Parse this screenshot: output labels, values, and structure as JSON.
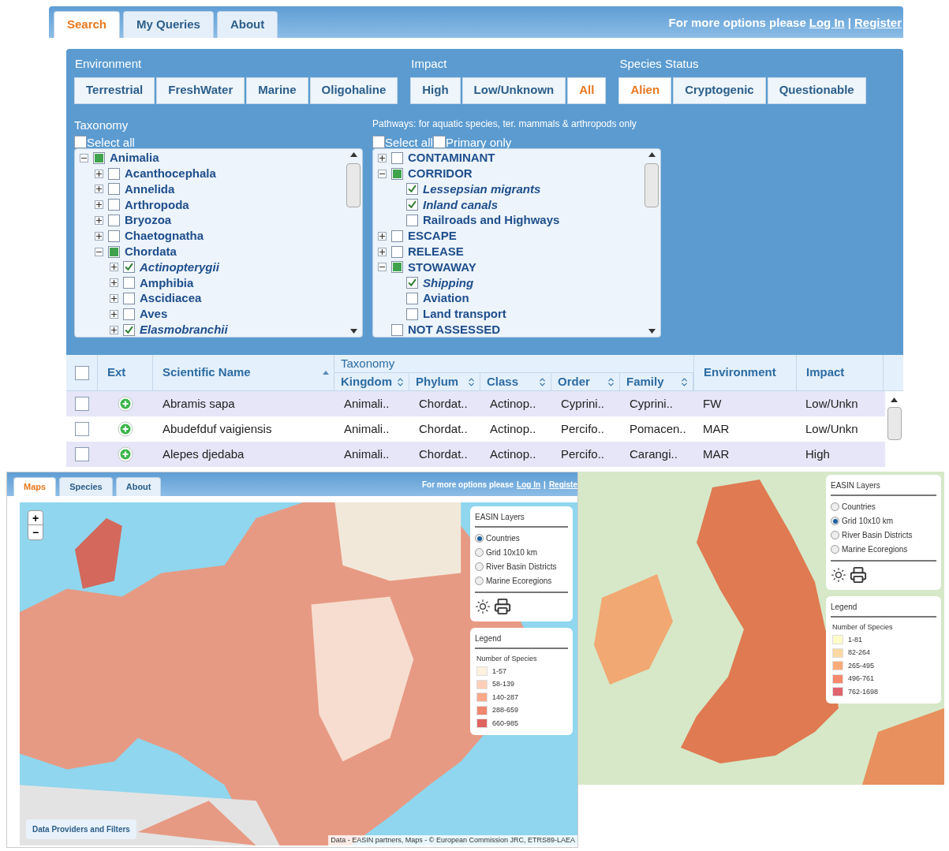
{
  "search_app": {
    "tabs": [
      {
        "label": "Search",
        "selected": true
      },
      {
        "label": "My Queries",
        "selected": false
      },
      {
        "label": "About",
        "selected": false
      }
    ],
    "login_prompt": {
      "text": "For more options please",
      "login": "Log In",
      "separator": "|",
      "register": "Register"
    },
    "filters": [
      {
        "title": "Environment",
        "options": [
          {
            "label": "Terrestrial",
            "selected": false
          },
          {
            "label": "FreshWater",
            "selected": false
          },
          {
            "label": "Marine",
            "selected": false
          },
          {
            "label": "Oligohaline",
            "selected": false
          }
        ]
      },
      {
        "title": "Impact",
        "options": [
          {
            "label": "High",
            "selected": false
          },
          {
            "label": "Low/Unknown",
            "selected": false
          },
          {
            "label": "All",
            "selected": true
          }
        ]
      },
      {
        "title": "Species Status",
        "options": [
          {
            "label": "Alien",
            "selected": true
          },
          {
            "label": "Cryptogenic",
            "selected": false
          },
          {
            "label": "Questionable",
            "selected": false
          }
        ]
      }
    ],
    "taxonomy": {
      "title": "Taxonomy",
      "select_all": {
        "label": "Select all",
        "checked": false
      },
      "tree": [
        {
          "label": "Animalia",
          "expanded": true,
          "checked": false,
          "partial": true,
          "children": [
            {
              "label": "Acanthocephala",
              "expanded": false,
              "checked": false
            },
            {
              "label": "Annelida",
              "expanded": false,
              "checked": false
            },
            {
              "label": "Arthropoda",
              "expanded": false,
              "checked": false
            },
            {
              "label": "Bryozoa",
              "expanded": false,
              "checked": false
            },
            {
              "label": "Chaetognatha",
              "expanded": false,
              "checked": false
            },
            {
              "label": "Chordata",
              "expanded": true,
              "checked": false,
              "partial": true,
              "children": [
                {
                  "label": "Actinopterygii",
                  "expanded": false,
                  "checked": true
                },
                {
                  "label": "Amphibia",
                  "expanded": false,
                  "checked": false
                },
                {
                  "label": "Ascidiacea",
                  "expanded": false,
                  "checked": false
                },
                {
                  "label": "Aves",
                  "expanded": false,
                  "checked": false
                },
                {
                  "label": "Elasmobranchii",
                  "expanded": false,
                  "checked": true
                }
              ]
            }
          ]
        }
      ]
    },
    "pathways": {
      "title": "Pathways: for aquatic species, ter. mammals & arthropods only",
      "select_all": {
        "label": "Select all",
        "checked": false
      },
      "primary_only": {
        "label": "Primary only",
        "checked": false
      },
      "tree": [
        {
          "label": "CONTAMINANT",
          "expanded": false,
          "checked": false
        },
        {
          "label": "CORRIDOR",
          "expanded": true,
          "checked": false,
          "partial": true,
          "children": [
            {
              "label": "Lessepsian migrants",
              "checked": true
            },
            {
              "label": "Inland canals",
              "checked": true
            },
            {
              "label": "Railroads and Highways",
              "checked": false
            }
          ]
        },
        {
          "label": "ESCAPE",
          "expanded": false,
          "checked": false
        },
        {
          "label": "RELEASE",
          "expanded": false,
          "checked": false
        },
        {
          "label": "STOWAWAY",
          "expanded": true,
          "checked": false,
          "partial": true,
          "children": [
            {
              "label": "Shipping",
              "checked": true
            },
            {
              "label": "Aviation",
              "checked": false
            },
            {
              "label": "Land transport",
              "checked": false
            }
          ]
        },
        {
          "label": "NOT ASSESSED",
          "checked": false
        }
      ]
    },
    "table": {
      "select_all_checked": false,
      "group_label": "Taxonomy",
      "columns": [
        {
          "label": "Ext",
          "kind": "plain"
        },
        {
          "label": "Scientific Name",
          "kind": "sorted"
        },
        {
          "label": "Kingdom",
          "kind": "group"
        },
        {
          "label": "Phylum",
          "kind": "group"
        },
        {
          "label": "Class",
          "kind": "group"
        },
        {
          "label": "Order",
          "kind": "group"
        },
        {
          "label": "Family",
          "kind": "group"
        },
        {
          "label": "Environment",
          "kind": "plain"
        },
        {
          "label": "Impact",
          "kind": "plain"
        }
      ],
      "rows": [
        {
          "checked": false,
          "cells": [
            "",
            "Abramis sapa",
            "Animali..",
            "Chordat..",
            "Actinop..",
            "Cyprini..",
            "Cyprini..",
            "FW",
            "Low/Unkn"
          ]
        },
        {
          "checked": false,
          "cells": [
            "",
            "Abudefduf vaigiensis",
            "Animali..",
            "Chordat..",
            "Actinop..",
            "Percifo..",
            "Pomacen..",
            "MAR",
            "Low/Unkn"
          ]
        },
        {
          "checked": false,
          "cells": [
            "",
            "Alepes djedaba",
            "Animali..",
            "Chordat..",
            "Actinop..",
            "Percifo..",
            "Carangi..",
            "MAR",
            "High"
          ]
        }
      ]
    }
  },
  "maps_app": {
    "tabs": [
      {
        "label": "Maps",
        "selected": true
      },
      {
        "label": "Species",
        "selected": false
      },
      {
        "label": "About",
        "selected": false
      }
    ],
    "login_prompt": {
      "text": "For more options please",
      "login": "Log In",
      "separator": "|",
      "register": "Registe"
    },
    "zoom": {
      "in": "+",
      "out": "−"
    },
    "layers": {
      "title": "EASIN Layers",
      "options": [
        {
          "label": "Countries",
          "selected": true
        },
        {
          "label": "Grid 10x10 km",
          "selected": false
        },
        {
          "label": "River Basin Districts",
          "selected": false
        },
        {
          "label": "Marine Ecoregions",
          "selected": false
        }
      ]
    },
    "legend": {
      "title": "Legend",
      "subtitle": "Number of Species",
      "items": [
        {
          "label": "1-57",
          "color": "#fdf1df"
        },
        {
          "label": "58-139",
          "color": "#fcd0b8"
        },
        {
          "label": "140-287",
          "color": "#f9a88a"
        },
        {
          "label": "288-659",
          "color": "#ee8670"
        },
        {
          "label": "660-985",
          "color": "#de6560"
        }
      ]
    },
    "providers_button": "Data Providers and Filters",
    "attribution": "Data - EASIN partners, Maps - © European Commission JRC, ETRS89-LAEA"
  },
  "grid_map": {
    "layers": {
      "title": "EASIN Layers",
      "options": [
        {
          "label": "Countries",
          "selected": false
        },
        {
          "label": "Grid 10x10 km",
          "selected": true
        },
        {
          "label": "River Basin Districts",
          "selected": false
        },
        {
          "label": "Marine Ecoregions",
          "selected": false
        }
      ]
    },
    "legend": {
      "title": "Legend",
      "subtitle": "Number of Species",
      "items": [
        {
          "label": "1-81",
          "color": "#fdfcc8"
        },
        {
          "label": "82-264",
          "color": "#fdd8a0"
        },
        {
          "label": "265-495",
          "color": "#fcab78"
        },
        {
          "label": "496-761",
          "color": "#f48a6b"
        },
        {
          "label": "762-1698",
          "color": "#e0646e"
        }
      ]
    }
  }
}
